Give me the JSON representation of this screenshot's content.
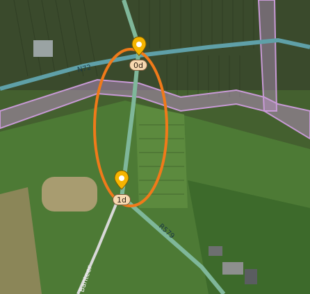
{
  "map": {
    "roads": [
      {
        "label": "N72",
        "color": "#5fa0a8"
      },
      {
        "label": "R579",
        "color": "#7fb79a"
      },
      {
        "label": "Banteer",
        "color": "#d8d8d8"
      }
    ],
    "boundary_color": "#c89ad6",
    "highlight_color": "#f07a1a",
    "markers": [
      {
        "label": "0d",
        "icon": "map-pin-icon",
        "color": "#f5b400"
      },
      {
        "label": "1d",
        "icon": "map-pin-icon",
        "color": "#f5b400"
      }
    ]
  }
}
